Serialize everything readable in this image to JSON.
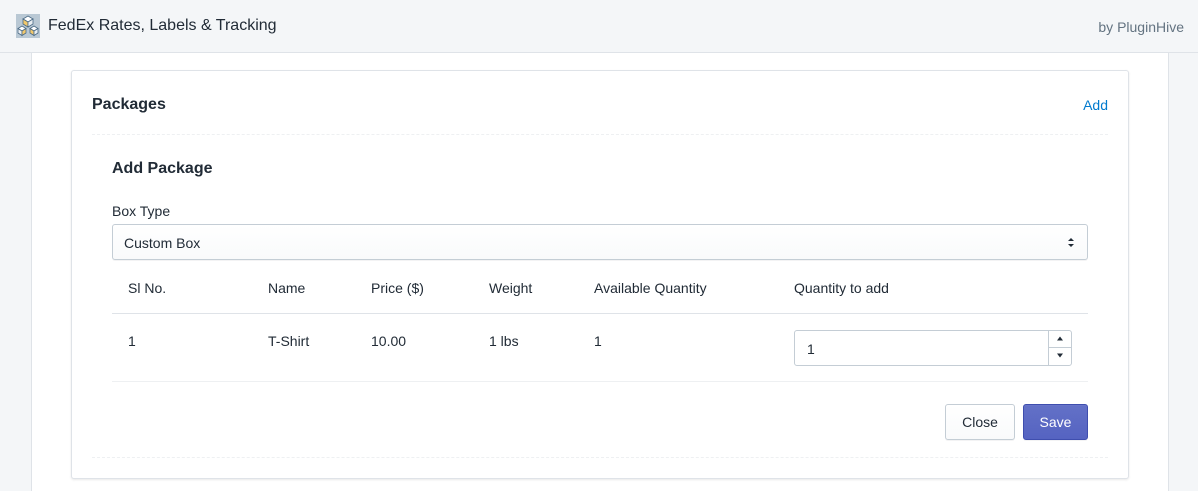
{
  "header": {
    "app_title": "FedEx Rates, Labels & Tracking",
    "byline": "by PluginHive",
    "logo_icon": "package-boxes-icon"
  },
  "packages_card": {
    "title": "Packages",
    "add_link": "Add",
    "add_package": {
      "title": "Add Package",
      "box_type": {
        "label": "Box Type",
        "selected": "Custom Box"
      },
      "table": {
        "headers": [
          "Sl No.",
          "Name",
          "Price ($)",
          "Weight",
          "Available Quantity",
          "Quantity to add"
        ],
        "rows": [
          {
            "sl_no": "1",
            "name": "T-Shirt",
            "price": "10.00",
            "weight": "1 lbs",
            "available_quantity": "1",
            "quantity_to_add": "1"
          }
        ]
      },
      "close_button": "Close",
      "save_button": "Save"
    }
  },
  "colors": {
    "accent": "#5c6ac4",
    "link": "#007ace",
    "background": "#f4f6f8"
  }
}
